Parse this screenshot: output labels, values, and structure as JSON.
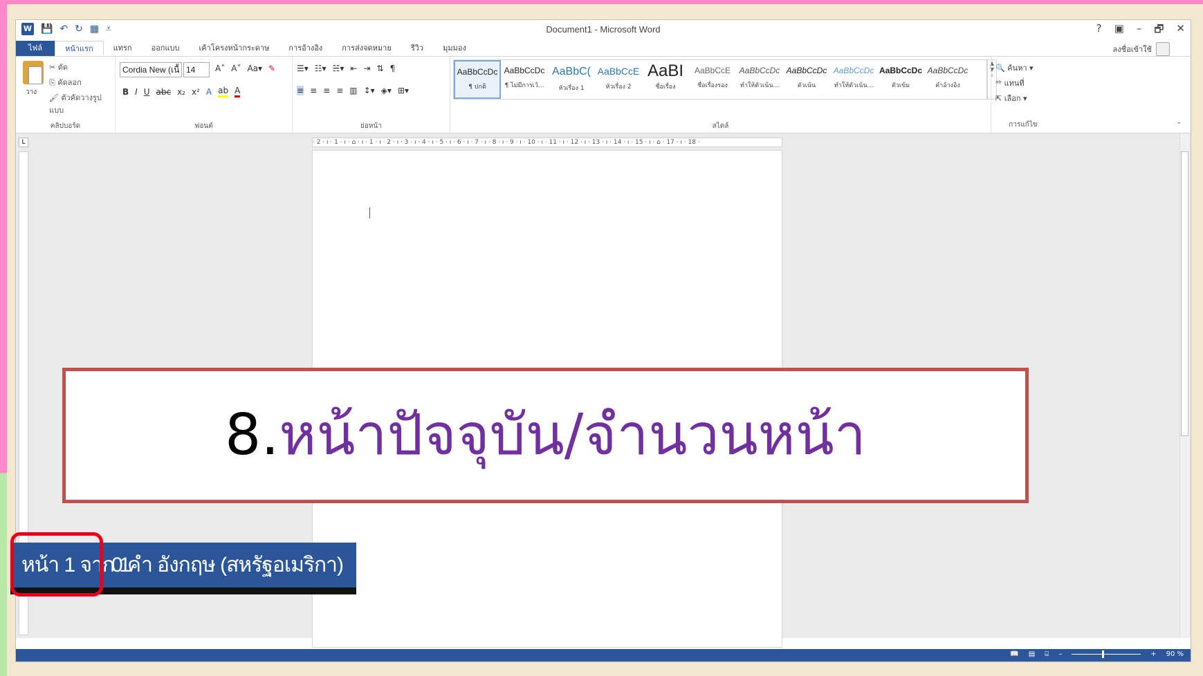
{
  "window": {
    "title": "Document1 - Microsoft Word",
    "controls": [
      "?",
      "▣",
      "–",
      "🗗",
      "✕"
    ]
  },
  "tabs": [
    {
      "label": "ไฟล์"
    },
    {
      "label": "หน้าแรก"
    },
    {
      "label": "แทรก"
    },
    {
      "label": "ออกแบบ"
    },
    {
      "label": "เค้าโครงหน้ากระดาษ"
    },
    {
      "label": "การอ้างอิง"
    },
    {
      "label": "การส่งจดหมาย"
    },
    {
      "label": "รีวิว"
    },
    {
      "label": "มุมมอง"
    }
  ],
  "signin": "ลงชื่อเข้าใช้",
  "ribbon": {
    "clipboard": {
      "label": "คลิปบอร์ด",
      "paste": "วาง",
      "cut": "ตัด",
      "copy": "คัดลอก",
      "format_painter": "ตัวคัดวางรูปแบบ"
    },
    "font": {
      "label": "ฟอนต์",
      "name": "Cordia New (เนื้",
      "size": "14"
    },
    "paragraph": {
      "label": "ย่อหน้า"
    },
    "styles": {
      "label": "สไตล์",
      "items": [
        {
          "sample": "AaBbCcDc",
          "name": "¶ ปกติ"
        },
        {
          "sample": "AaBbCcDc",
          "name": "¶ ไม่มีการเว้..."
        },
        {
          "sample": "AaBbC(",
          "name": "หัวเรื่อง 1"
        },
        {
          "sample": "AaBbCcE",
          "name": "หัวเรื่อง 2"
        },
        {
          "sample": "AaBI",
          "name": "ชื่อเรื่อง"
        },
        {
          "sample": "AaBbCcE",
          "name": "ชื่อเรื่องรอง"
        },
        {
          "sample": "AaBbCcDc",
          "name": "ทำให้ตัวเน้น..."
        },
        {
          "sample": "AaBbCcDc",
          "name": "ตัวเน้น"
        },
        {
          "sample": "AaBbCcDc",
          "name": "ทำให้ตัวเน้น..."
        },
        {
          "sample": "AaBbCcDc",
          "name": "ตัวเข้ม"
        },
        {
          "sample": "AaBbCcDc",
          "name": "คำอ้างอิง"
        }
      ]
    },
    "editing": {
      "label": "การแก้ไข",
      "find": "ค้นหา",
      "replace": "แทนที่",
      "select": "เลือก"
    }
  },
  "ruler": "· 2 · ı · 1 · ı · ⌂ · ı · 1 · ı · 2 · ı · 3 · ı · 4 · ı · 5 · ı · 6 · ı · 7 · ı · 8 · ı · 9 · ı · 10 · ı · 11 · ı · 12 · ı · 13 · ı · 14 · ı · 15 · ı · ⌂ · 17 · ı · 18 ·",
  "statusbar": {
    "zoom": "90 %"
  },
  "zoomed_status": {
    "page": "หน้า 1 จาก 1",
    "words": "0 คำ",
    "language": "อังกฤษ (สหรัฐอเมริกา)"
  },
  "caption": {
    "number": "8.",
    "text": "หน้าปัจจุบัน/จำนวนหน้า"
  },
  "colors": {
    "word_blue": "#2b579a",
    "caption_border": "#c0504d",
    "caption_text": "#7030a0",
    "highlight": "#e8001c"
  }
}
